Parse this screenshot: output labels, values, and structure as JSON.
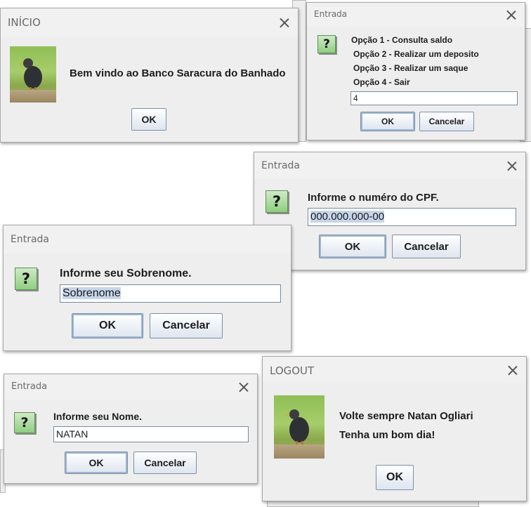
{
  "inicio": {
    "title": "INÍCIO",
    "message": "Bem vindo ao Banco Saracura do Banhado",
    "ok_label": "OK"
  },
  "menu": {
    "title": "Entrada",
    "options": [
      "Opção 1 - Consulta saldo",
      "Opção 2 - Realizar um deposito",
      "Opção 3 - Realizar um saque",
      "Opção 4 - Sair"
    ],
    "input_value": "4",
    "ok_label": "OK",
    "cancel_label": "Cancelar"
  },
  "cpf": {
    "title": "Entrada",
    "prompt": "Informe o numéro do CPF.",
    "input_value": "000.000.000-00",
    "ok_label": "OK",
    "cancel_label": "Cancelar"
  },
  "sobrenome": {
    "title": "Entrada",
    "prompt": "Informe seu Sobrenome.",
    "input_value": "Sobrenome",
    "ok_label": "OK",
    "cancel_label": "Cancelar"
  },
  "nome": {
    "title": "Entrada",
    "prompt": "Informe seu Nome.",
    "input_value": "NATAN",
    "ok_label": "OK",
    "cancel_label": "Cancelar"
  },
  "logout": {
    "title": "LOGOUT",
    "line1": "Volte sempre Natan Ogliari",
    "line2": "Tenha um bom dia!",
    "ok_label": "OK"
  },
  "icons": {
    "question": "?",
    "question_icon_name": "question-icon",
    "bird_icon_name": "saracura-bird-icon",
    "close_icon_name": "close-icon"
  },
  "colors": {
    "dialog_bg": "#eeeeee",
    "question_icon_green": "#8fcf80",
    "button_border": "#7e8fa6",
    "selection": "#c6d6ea"
  }
}
